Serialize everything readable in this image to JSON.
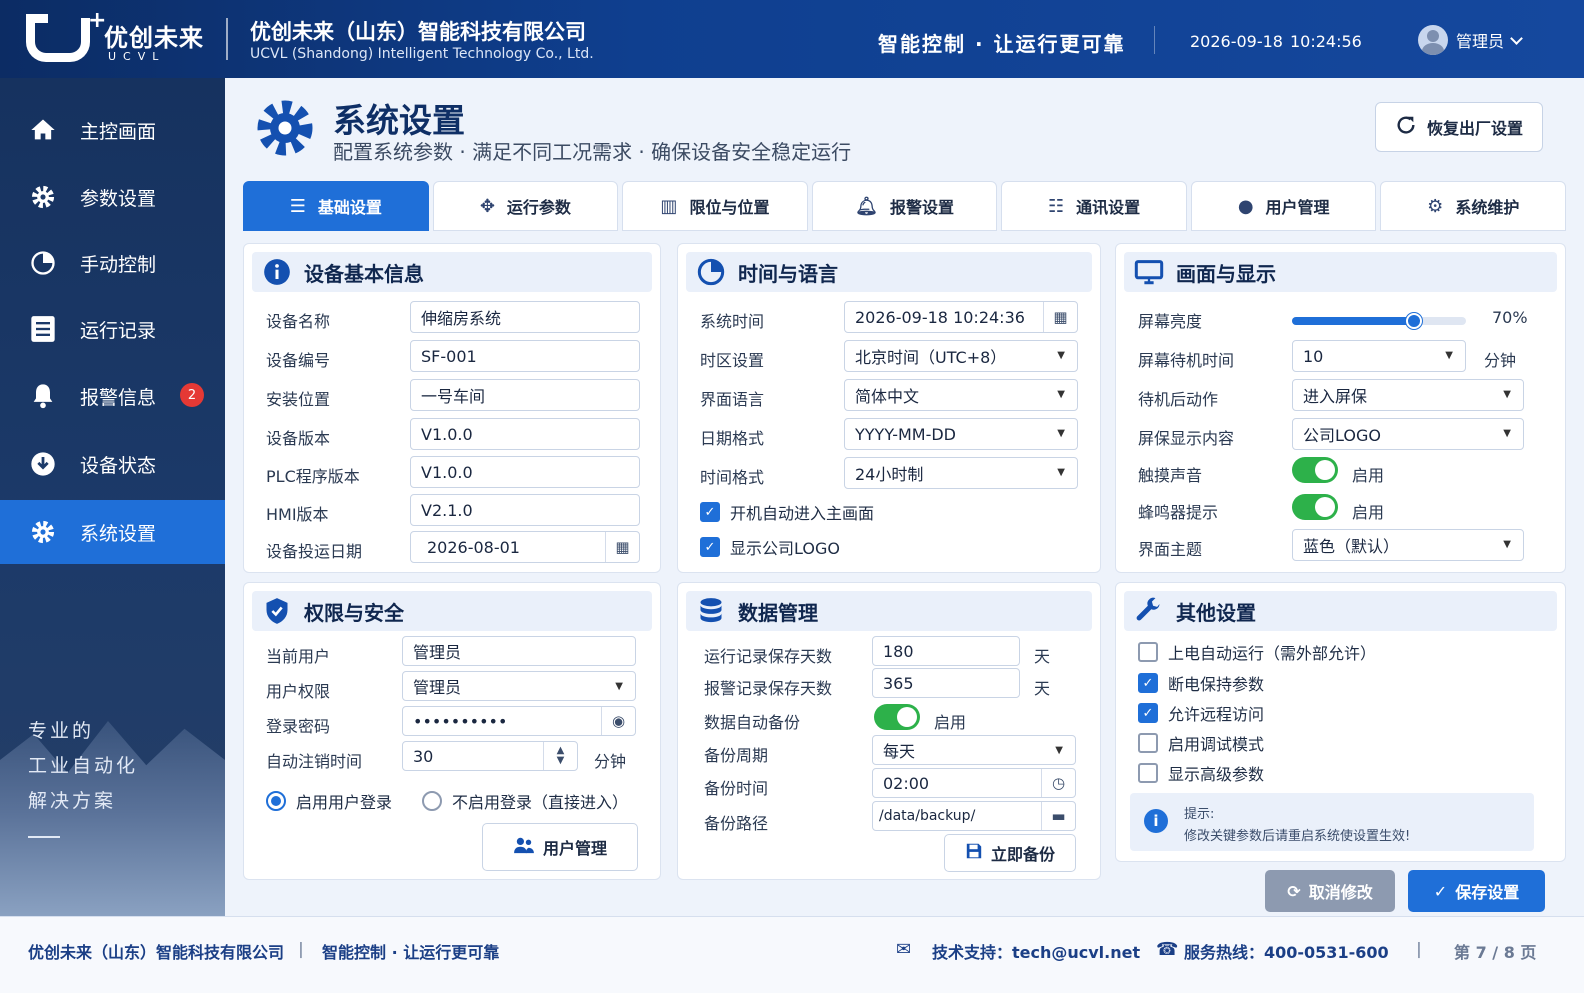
{
  "header": {
    "logo_cn": "优创未来",
    "logo_en": "UCVL",
    "company_cn": "优创未来（山东）智能科技有限公司",
    "company_en": "UCVL (Shandong) Intelligent Technology Co., Ltd.",
    "slogan": "智能控制 · 让运行更可靠",
    "date": "2026-09-18",
    "time": "10:24:56",
    "user": "管理员"
  },
  "sidebar": {
    "items": [
      {
        "label": "主控画面",
        "icon": "home-icon"
      },
      {
        "label": "参数设置",
        "icon": "gear-icon"
      },
      {
        "label": "手动控制",
        "icon": "hand-icon"
      },
      {
        "label": "运行记录",
        "icon": "list-icon"
      },
      {
        "label": "报警信息",
        "icon": "bell-icon",
        "badge": "2"
      },
      {
        "label": "设备状态",
        "icon": "download-icon"
      },
      {
        "label": "系统设置",
        "icon": "gear-icon",
        "active": true
      }
    ],
    "tagline_1": "专业的",
    "tagline_2": "工业自动化",
    "tagline_3": "解决方案"
  },
  "page": {
    "title": "系统设置",
    "subtitle": "配置系统参数 · 满足不同工况需求 · 确保设备安全稳定运行",
    "reset_label": "恢复出厂设置"
  },
  "tabs": [
    {
      "label": "基础设置",
      "active": true
    },
    {
      "label": "运行参数"
    },
    {
      "label": "限位与位置"
    },
    {
      "label": "报警设置"
    },
    {
      "label": "通讯设置"
    },
    {
      "label": "用户管理"
    },
    {
      "label": "系统维护"
    }
  ],
  "device": {
    "title": "设备基本信息",
    "rows": [
      {
        "label": "设备名称",
        "value": "伸缩房系统"
      },
      {
        "label": "设备编号",
        "value": "SF-001"
      },
      {
        "label": "安装位置",
        "value": "一号车间"
      },
      {
        "label": "设备版本",
        "value": "V1.0.0"
      },
      {
        "label": "PLC程序版本",
        "value": "V1.0.0"
      },
      {
        "label": "HMI版本",
        "value": "V2.1.0"
      },
      {
        "label": "设备投运日期",
        "value": "2026-08-01"
      }
    ]
  },
  "timelang": {
    "title": "时间与语言",
    "rows": [
      {
        "label": "系统时间",
        "value": "2026-09-18  10:24:36"
      },
      {
        "label": "时区设置",
        "value": "北京时间（UTC+8）"
      },
      {
        "label": "界面语言",
        "value": "简体中文"
      },
      {
        "label": "日期格式",
        "value": "YYYY-MM-DD"
      },
      {
        "label": "时间格式",
        "value": "24小时制"
      }
    ],
    "check_1": "开机自动进入主画面",
    "check_2": "显示公司LOGO"
  },
  "display": {
    "title": "画面与显示",
    "brightness_label": "屏幕亮度",
    "brightness_value": "70%",
    "brightness_level": 0.7,
    "standby_label": "屏幕待机时间",
    "standby_value": "10",
    "standby_unit": "分钟",
    "after_label": "待机后动作",
    "after_value": "进入屏保",
    "saver_label": "屏保显示内容",
    "saver_value": "公司LOGO",
    "touch_label": "触摸声音",
    "touch_state": "启用",
    "buzzer_label": "蜂鸣器提示",
    "buzzer_state": "启用",
    "theme_label": "界面主题",
    "theme_value": "蓝色（默认）"
  },
  "security": {
    "title": "权限与安全",
    "user_label": "当前用户",
    "user_value": "管理员",
    "perm_label": "用户权限",
    "perm_value": "管理员",
    "pwd_label": "登录密码",
    "pwd_value": "••••••••••",
    "logout_label": "自动注销时间",
    "logout_value": "30",
    "logout_unit": "分钟",
    "radio_1": "启用用户登录",
    "radio_2": "不启用登录（直接进入）",
    "manage_btn": "用户管理"
  },
  "data_mgmt": {
    "title": "数据管理",
    "run_label": "运行记录保存天数",
    "run_value": "180",
    "alarm_label": "报警记录保存天数",
    "alarm_value": "365",
    "day_unit": "天",
    "auto_label": "数据自动备份",
    "auto_state": "启用",
    "cycle_label": "备份周期",
    "cycle_value": "每天",
    "btime_label": "备份时间",
    "btime_value": "02:00",
    "path_label": "备份路径",
    "path_value": "/data/backup/",
    "backup_btn": "立即备份"
  },
  "other": {
    "title": "其他设置",
    "checks": [
      {
        "label": "上电自动运行（需外部允许）",
        "on": false
      },
      {
        "label": "断电保持参数",
        "on": true
      },
      {
        "label": "允许远程访问",
        "on": true
      },
      {
        "label": "启用调试模式",
        "on": false
      },
      {
        "label": "显示高级参数",
        "on": false
      }
    ],
    "tip_title": "提示:",
    "tip_msg": "修改关键参数后请重启系统使设置生效!"
  },
  "actions": {
    "cancel": "取消修改",
    "save": "保存设置"
  },
  "footer": {
    "company": "优创未来（山东）智能科技有限公司",
    "sep": "|",
    "slogan": "智能控制 · 让运行更可靠",
    "support": "技术支持：tech@ucvl.net",
    "hotline": "服务热线：400-0531-600",
    "page": "第 7 / 8 页"
  },
  "colors": {
    "primary": "#1f6fd8",
    "header": "#0f3f8f",
    "toggle": "#2db14a",
    "badge": "#e53935"
  }
}
